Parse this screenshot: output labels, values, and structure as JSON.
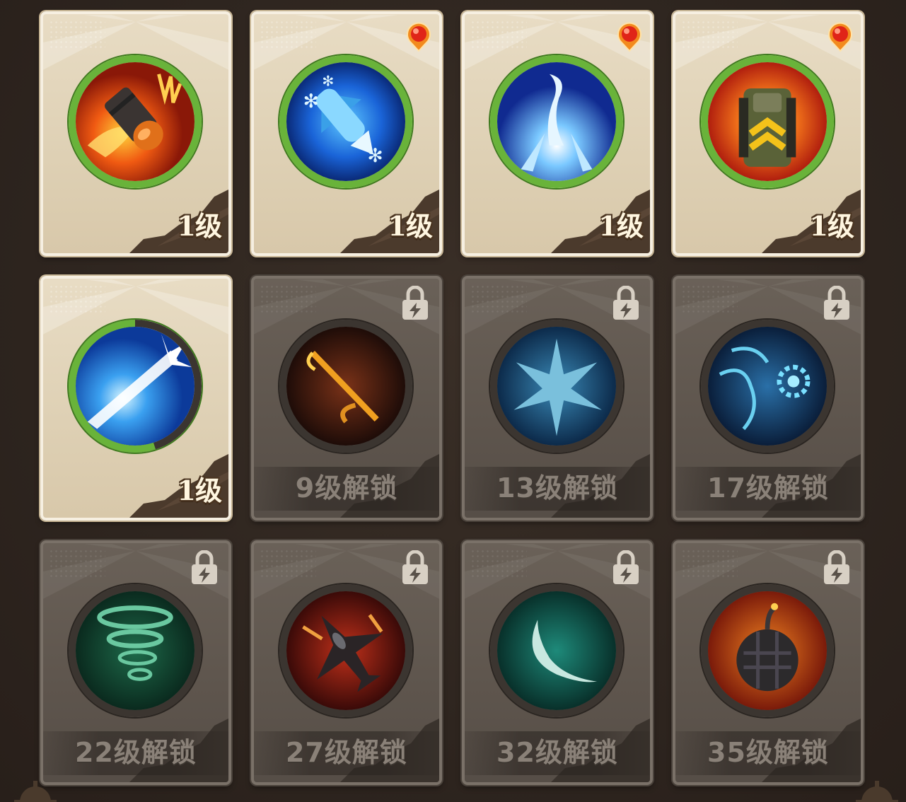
{
  "skills": [
    {
      "id": 1,
      "state": "unlocked",
      "level_label": "1级",
      "notif": false,
      "icon": "fire-bullet-icon",
      "progress": 1.0
    },
    {
      "id": 2,
      "state": "unlocked",
      "level_label": "1级",
      "notif": true,
      "icon": "ice-missile-icon",
      "progress": 1.0
    },
    {
      "id": 3,
      "state": "unlocked",
      "level_label": "1级",
      "notif": true,
      "icon": "ice-blast-icon",
      "progress": 1.0
    },
    {
      "id": 4,
      "state": "unlocked",
      "level_label": "1级",
      "notif": true,
      "icon": "armored-vehicle-icon",
      "progress": 1.0
    },
    {
      "id": 5,
      "state": "unlocked",
      "level_label": "1级",
      "notif": false,
      "icon": "energy-beam-icon",
      "progress": 0.55
    },
    {
      "id": 6,
      "state": "locked",
      "unlock_label": "9级解锁",
      "icon": "fire-arrow-icon"
    },
    {
      "id": 7,
      "state": "locked",
      "unlock_label": "13级解锁",
      "icon": "ice-crystal-icon"
    },
    {
      "id": 8,
      "state": "locked",
      "unlock_label": "17级解锁",
      "icon": "lightning-orb-icon"
    },
    {
      "id": 9,
      "state": "locked",
      "unlock_label": "22级解锁",
      "icon": "tornado-icon"
    },
    {
      "id": 10,
      "state": "locked",
      "unlock_label": "27级解锁",
      "icon": "fighter-jet-icon"
    },
    {
      "id": 11,
      "state": "locked",
      "unlock_label": "32级解锁",
      "icon": "wind-slash-icon"
    },
    {
      "id": 12,
      "state": "locked",
      "unlock_label": "35级解锁",
      "icon": "bomb-icon"
    }
  ],
  "colors": {
    "ring_green": "#69b33a",
    "card_unlocked": "#e8dcc4",
    "card_locked": "#5e554d",
    "notif_red": "#e02418",
    "notif_orange": "#f28a1e"
  }
}
